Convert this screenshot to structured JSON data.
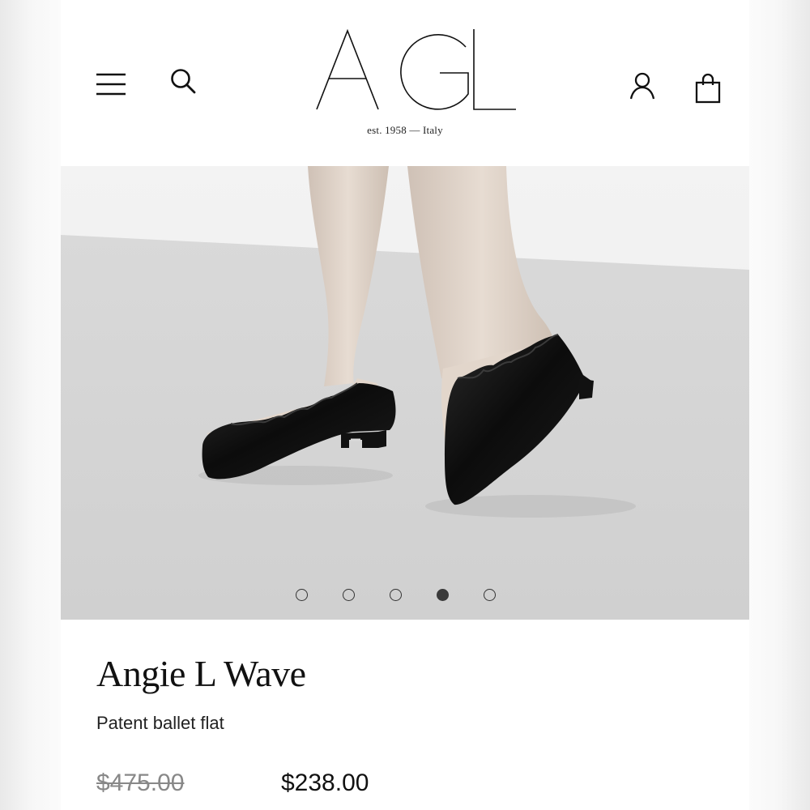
{
  "header": {
    "logo_text": "AGL",
    "tagline": "est. 1958 — Italy",
    "icons": [
      "menu-icon",
      "search-icon",
      "user-icon",
      "bag-icon"
    ]
  },
  "gallery": {
    "slide_count": 5,
    "active_index": 3
  },
  "product": {
    "name": "Angie L Wave",
    "subtitle": "Patent ballet flat",
    "original_price": "$475.00",
    "sale_price": "$238.00"
  },
  "colors": {
    "text": "#111111",
    "strikethrough_price": "#888888",
    "background": "#ffffff"
  }
}
